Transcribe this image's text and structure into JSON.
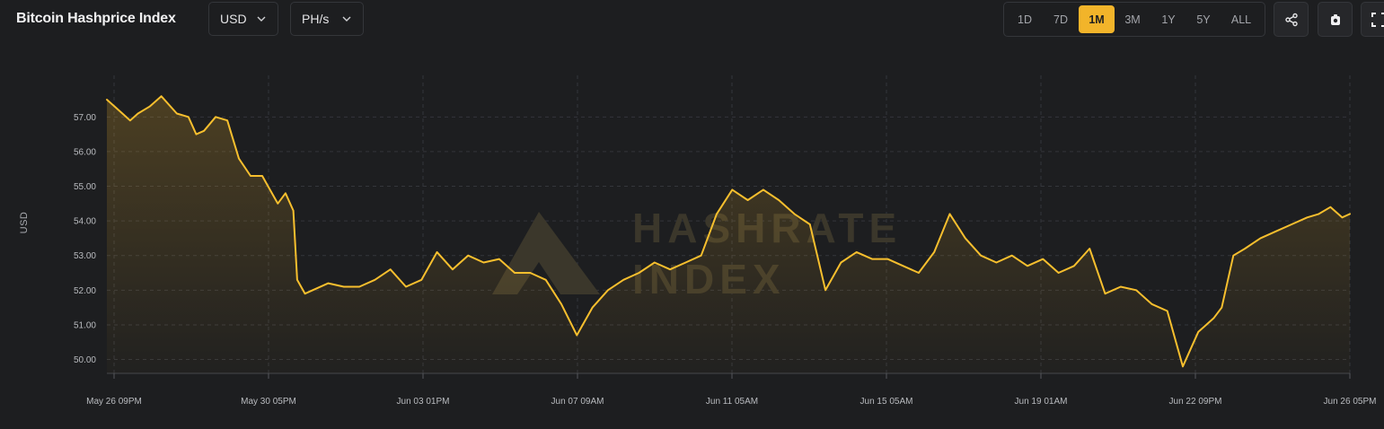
{
  "header": {
    "title": "Bitcoin Hashprice Index",
    "currency_select": "USD",
    "unit_select": "PH/s"
  },
  "ranges": [
    {
      "label": "1D",
      "active": false
    },
    {
      "label": "7D",
      "active": false
    },
    {
      "label": "1M",
      "active": true
    },
    {
      "label": "3M",
      "active": false
    },
    {
      "label": "1Y",
      "active": false
    },
    {
      "label": "5Y",
      "active": false
    },
    {
      "label": "ALL",
      "active": false
    }
  ],
  "toolbar": {
    "share_icon": "share-icon",
    "screenshot_icon": "screenshot-icon",
    "fullscreen_icon": "fullscreen-icon"
  },
  "watermark": [
    "HASHRATE",
    "INDEX"
  ],
  "colors": {
    "line": "#f7bf2e",
    "accent": "#f2b42a",
    "background": "#1d1e20",
    "grid": "#34363b"
  },
  "chart_data": {
    "type": "area",
    "title": "",
    "xlabel": "",
    "ylabel": "USD",
    "ylim": [
      49.6,
      58.2
    ],
    "grid": true,
    "yticks": [
      57.0,
      56.0,
      55.0,
      54.0,
      53.0,
      52.0,
      51.0,
      50.0
    ],
    "ytick_labels": [
      "57.00",
      "56.00",
      "55.00",
      "54.00",
      "53.00",
      "52.00",
      "51.00",
      "50.00"
    ],
    "xticks": [
      "May 26 09PM",
      "May 30 05PM",
      "Jun 03 01PM",
      "Jun 07 09AM",
      "Jun 11 05AM",
      "Jun 15 05AM",
      "Jun 19 01AM",
      "Jun 22 09PM",
      "Jun 26 05PM"
    ],
    "xlim_days": [
      -0.3,
      31.7
    ],
    "series": [
      {
        "name": "",
        "x": [
          -0.3,
          0.0,
          0.3,
          0.5,
          0.8,
          1.1,
          1.5,
          1.8,
          2.0,
          2.2,
          2.5,
          2.8,
          3.1,
          3.4,
          3.7,
          3.9,
          4.1,
          4.3,
          4.5,
          4.6,
          4.8,
          5.0,
          5.4,
          5.8,
          6.2,
          6.6,
          7.0,
          7.4,
          7.8,
          8.2,
          8.6,
          9.0,
          9.4,
          9.8,
          10.2,
          10.6,
          11.0,
          11.4,
          11.8,
          12.2,
          12.6,
          13.0,
          13.4,
          13.8,
          14.2,
          14.6,
          15.0,
          15.4,
          15.8,
          16.2,
          16.6,
          17.0,
          17.4,
          17.8,
          18.2,
          18.6,
          19.0,
          19.4,
          19.8,
          20.2,
          20.6,
          21.0,
          21.4,
          21.8,
          22.2,
          22.6,
          23.0,
          23.4,
          23.8,
          24.2,
          24.6,
          25.0,
          25.4,
          25.8,
          26.2,
          26.6,
          27.0,
          27.4,
          27.8,
          28.0,
          28.2,
          28.4,
          28.7,
          29.0,
          29.4,
          29.8,
          30.2,
          30.6,
          30.9,
          31.2,
          31.5,
          31.7
        ],
        "y": [
          57.5,
          57.2,
          56.9,
          57.1,
          57.3,
          57.6,
          57.1,
          57.0,
          56.5,
          56.6,
          57.0,
          56.9,
          55.8,
          55.3,
          55.3,
          54.9,
          54.5,
          54.8,
          54.3,
          52.3,
          51.9,
          52.0,
          52.2,
          52.1,
          52.1,
          52.3,
          52.6,
          52.1,
          52.3,
          53.1,
          52.6,
          53.0,
          52.8,
          52.9,
          52.5,
          52.5,
          52.3,
          51.6,
          50.7,
          51.5,
          52.0,
          52.3,
          52.5,
          52.8,
          52.6,
          52.8,
          53.0,
          54.2,
          54.9,
          54.6,
          54.9,
          54.6,
          54.2,
          53.9,
          52.0,
          52.8,
          53.1,
          52.9,
          52.9,
          52.7,
          52.5,
          53.1,
          54.2,
          53.5,
          53.0,
          52.8,
          53.0,
          52.7,
          52.9,
          52.5,
          52.7,
          53.2,
          51.9,
          52.1,
          52.0,
          51.6,
          51.4,
          49.8,
          50.8,
          51.0,
          51.2,
          51.5,
          53.0,
          53.2,
          53.5,
          53.7,
          53.9,
          54.1,
          54.2,
          54.4,
          54.1,
          54.2
        ]
      }
    ]
  }
}
